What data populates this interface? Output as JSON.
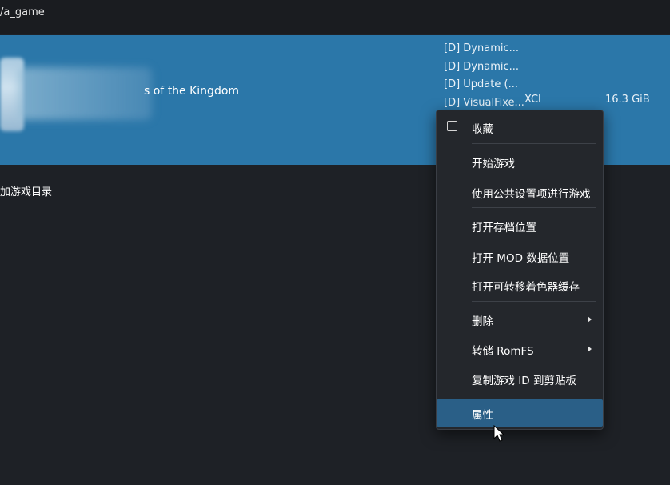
{
  "header": {
    "path": "/a_game"
  },
  "game_row": {
    "title": "s of the Kingdom",
    "updates": [
      "[D] Dynamic...",
      "[D] Dynamic...",
      "[D] Update (...",
      "[D] VisualFixe..."
    ],
    "format": "XCI",
    "size": "16.3 GiB"
  },
  "add_directory": {
    "label": "加游戏目录"
  },
  "context_menu": {
    "items": [
      {
        "label": "收藏",
        "checkbox": true,
        "checked": false
      },
      {
        "label": "开始游戏"
      },
      {
        "label": "使用公共设置项进行游戏"
      },
      {
        "label": "打开存档位置"
      },
      {
        "label": "打开 MOD 数据位置"
      },
      {
        "label": "打开可转移着色器缓存"
      },
      {
        "label": "删除",
        "submenu": true
      },
      {
        "label": "转储 RomFS",
        "submenu": true
      },
      {
        "label": "复制游戏 ID 到剪贴板"
      },
      {
        "label": "属性",
        "highlighted": true
      }
    ]
  },
  "colors": {
    "selected_row": "#2b77a9",
    "menu_background": "#24272c",
    "menu_highlight": "#2a5f87",
    "window_background": "#1e2126"
  }
}
